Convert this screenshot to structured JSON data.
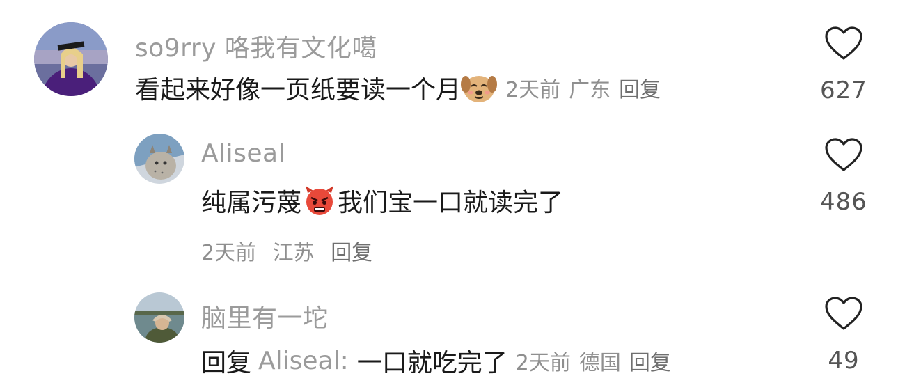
{
  "comments": [
    {
      "username": "so9rry 咯我有文化噶",
      "text": "看起来好像一页纸要读一个月",
      "emoji": "dog-blush-emoji",
      "time": "2天前",
      "location": "广东",
      "reply_label": "回复",
      "likes": "627"
    },
    {
      "username": "Aliseal",
      "text_before": "纯属污蔑",
      "emoji": "angry-devil-emoji",
      "text_after": "我们宝一口就读完了",
      "time": "2天前",
      "location": "江苏",
      "reply_label": "回复",
      "likes": "486"
    },
    {
      "username": "脑里有一坨",
      "reply_prefix": "回复",
      "reply_target": "Aliseal:",
      "text": "一口就吃完了",
      "time": "2天前",
      "location": "德国",
      "reply_label": "回复",
      "likes": "49"
    }
  ],
  "colors": {
    "username": "#9b9b9b",
    "meta": "#8f8f8f",
    "text": "#1a1a1a",
    "heart_stroke": "#222222"
  }
}
